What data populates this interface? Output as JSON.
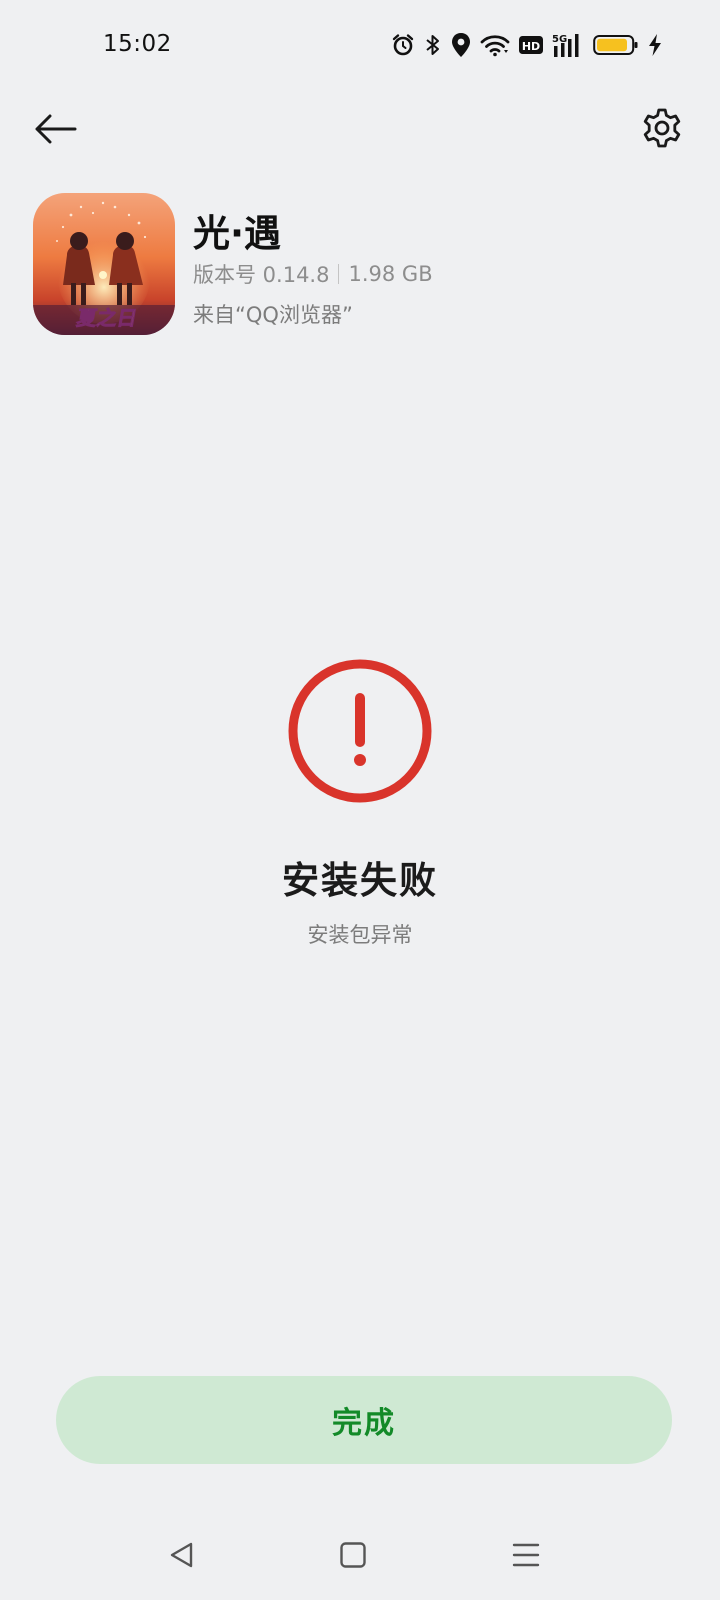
{
  "status_bar": {
    "time": "15:02",
    "icons": [
      "alarm-icon",
      "bluetooth-icon",
      "location-icon",
      "wifi-icon",
      "hd-icon",
      "5g-signal-icon",
      "battery-icon",
      "charging-icon"
    ],
    "hd_label": "HD",
    "network_label": "5G",
    "battery_color": "#f6c11f"
  },
  "top_bar": {
    "back_icon": "arrow-left-icon",
    "settings_icon": "gear-icon"
  },
  "app": {
    "name": "光·遇",
    "version": "版本号 0.14.8",
    "size": "1.98 GB",
    "source": "来自“QQ浏览器”",
    "icon_badge": "夏之日"
  },
  "result": {
    "icon": "error-exclamation-icon",
    "icon_color": "#d9342b",
    "title": "安装失败",
    "reason": "安装包异常"
  },
  "done_button": {
    "label": "完成",
    "background": "#cfe9d3",
    "text_color": "#138a28"
  },
  "nav_bar": {
    "icons": [
      "nav-back-icon",
      "nav-home-icon",
      "nav-recents-icon"
    ]
  }
}
